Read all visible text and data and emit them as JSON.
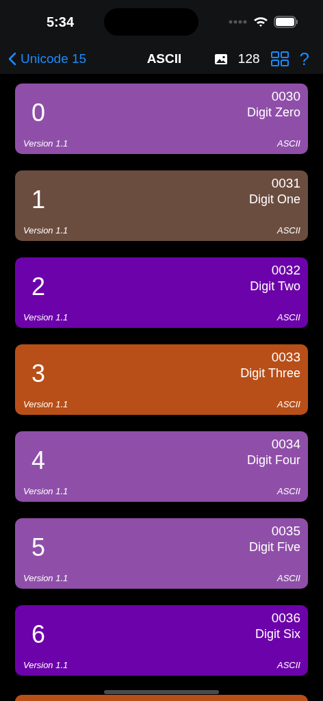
{
  "status_bar": {
    "time": "5:34"
  },
  "nav": {
    "back": "Unicode 15",
    "title": "ASCII",
    "count": "128",
    "help": "?"
  },
  "cards": [
    {
      "char": "0",
      "code": "0030",
      "name": "Digit Zero",
      "version": "Version 1.1",
      "block": "ASCII",
      "color": "#8f4fa9"
    },
    {
      "char": "1",
      "code": "0031",
      "name": "Digit One",
      "version": "Version 1.1",
      "block": "ASCII",
      "color": "#6b4d40"
    },
    {
      "char": "2",
      "code": "0032",
      "name": "Digit Two",
      "version": "Version 1.1",
      "block": "ASCII",
      "color": "#6c02a9"
    },
    {
      "char": "3",
      "code": "0033",
      "name": "Digit Three",
      "version": "Version 1.1",
      "block": "ASCII",
      "color": "#b84f18"
    },
    {
      "char": "4",
      "code": "0034",
      "name": "Digit Four",
      "version": "Version 1.1",
      "block": "ASCII",
      "color": "#8f4fa9"
    },
    {
      "char": "5",
      "code": "0035",
      "name": "Digit Five",
      "version": "Version 1.1",
      "block": "ASCII",
      "color": "#8f4fa9"
    },
    {
      "char": "6",
      "code": "0036",
      "name": "Digit Six",
      "version": "Version 1.1",
      "block": "ASCII",
      "color": "#6c02a9"
    },
    {
      "color": "#b84f18"
    }
  ]
}
